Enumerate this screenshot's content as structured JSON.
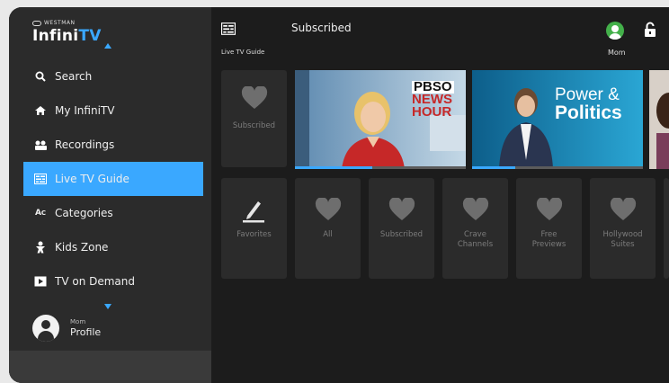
{
  "brand": {
    "small": "WESTMAN",
    "main_a": "Infini",
    "main_b": "TV"
  },
  "nav": [
    {
      "label": "Search",
      "icon": "search-icon"
    },
    {
      "label": "My InfiniTV",
      "icon": "home-icon"
    },
    {
      "label": "Recordings",
      "icon": "recordings-icon"
    },
    {
      "label": "Live TV Guide",
      "icon": "guide-icon",
      "active": true
    },
    {
      "label": "Categories",
      "icon": "categories-icon"
    },
    {
      "label": "Kids Zone",
      "icon": "kids-icon"
    },
    {
      "label": "TV on Demand",
      "icon": "on-demand-icon"
    }
  ],
  "profile": {
    "who": "Mom",
    "label": "Profile"
  },
  "header": {
    "guide_label": "Live TV Guide",
    "title": "Subscribed",
    "user": "Mom"
  },
  "row1": {
    "first_tile": {
      "label": "Subscribed",
      "icon": "heart-icon"
    },
    "posters": [
      {
        "logo_line1": "PBSO",
        "logo_line2": "NEWS",
        "logo_line3": "HOUR",
        "progress": 0.45
      },
      {
        "logo_line1": "Power &",
        "logo_line2": "Politics",
        "progress": 0.25
      }
    ]
  },
  "categories": [
    {
      "label": "Favorites",
      "icon": "pencil-icon"
    },
    {
      "label": "All",
      "icon": "heart-icon"
    },
    {
      "label": "Subscribed",
      "icon": "heart-icon"
    },
    {
      "label": "Crave Channels",
      "icon": "heart-icon"
    },
    {
      "label": "Free Previews",
      "icon": "heart-icon"
    },
    {
      "label": "Hollywood Suites",
      "icon": "heart-icon"
    }
  ],
  "colors": {
    "accent": "#3aa8ff",
    "sidebar": "#2b2b2b",
    "background": "#1c1c1c",
    "tile": "#2b2b2b"
  }
}
